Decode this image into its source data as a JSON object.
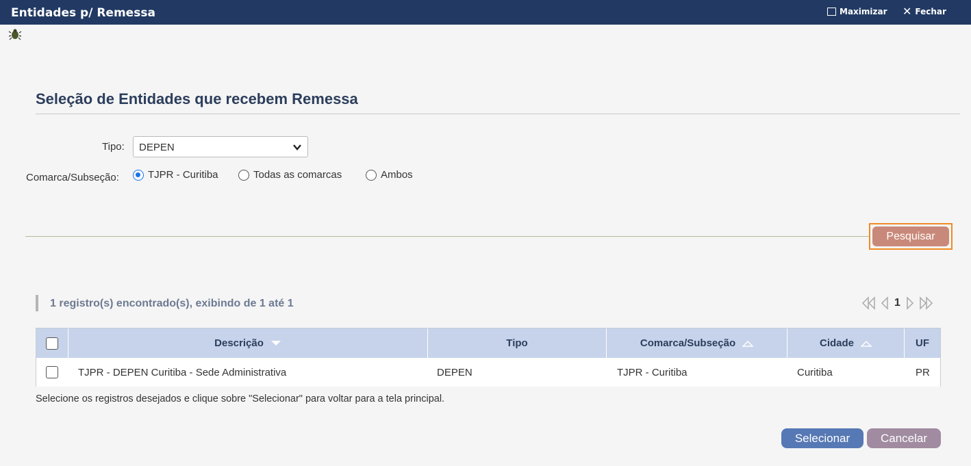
{
  "window": {
    "title": "Entidades p/ Remessa",
    "maximize_label": "Maximizar",
    "close_label": "Fechar"
  },
  "section": {
    "title": "Seleção de Entidades que recebem Remessa"
  },
  "form": {
    "tipo_label": "Tipo:",
    "tipo_value": "DEPEN",
    "comarca_label": "Comarca/Subseção:",
    "radio_options": [
      {
        "label": "TJPR - Curitiba",
        "checked": true
      },
      {
        "label": "Todas as comarcas",
        "checked": false
      },
      {
        "label": "Ambos",
        "checked": false
      }
    ],
    "search_button": "Pesquisar"
  },
  "results": {
    "summary": "1 registro(s) encontrado(s), exibindo de 1 até 1",
    "current_page": "1"
  },
  "table": {
    "columns": [
      "Descrição",
      "Tipo",
      "Comarca/Subseção",
      "Cidade",
      "UF"
    ],
    "rows": [
      {
        "descricao": "TJPR - DEPEN Curitiba - Sede Administrativa",
        "tipo": "DEPEN",
        "comarca": "TJPR - Curitiba",
        "cidade": "Curitiba",
        "uf": "PR"
      }
    ]
  },
  "hint": "Selecione os registros desejados e clique sobre \"Selecionar\" para voltar para a tela principal.",
  "actions": {
    "select_label": "Selecionar",
    "cancel_label": "Cancelar"
  },
  "colors": {
    "titlebar": "#223a63",
    "table_header": "#c6d3ea",
    "select_button": "#5678b4",
    "cancel_button": "#a08ba0",
    "search_button": "#c9897a",
    "search_focus": "#f08a24"
  }
}
